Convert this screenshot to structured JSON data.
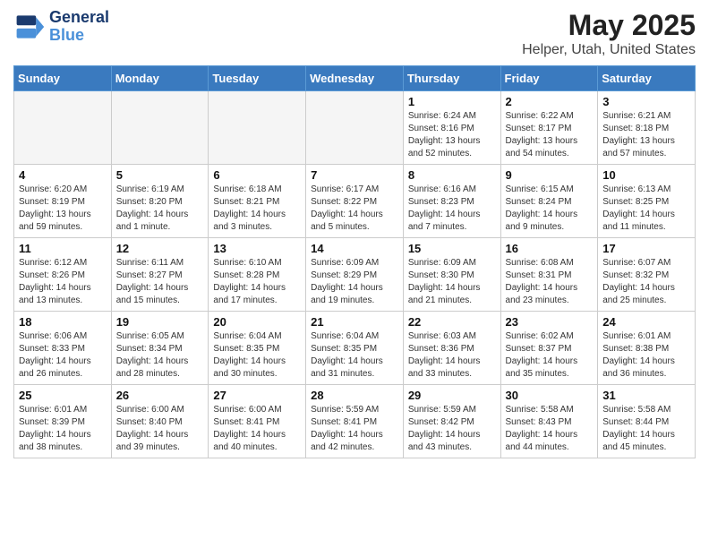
{
  "header": {
    "logo_line1": "General",
    "logo_line2": "Blue",
    "title": "May 2025",
    "subtitle": "Helper, Utah, United States"
  },
  "weekdays": [
    "Sunday",
    "Monday",
    "Tuesday",
    "Wednesday",
    "Thursday",
    "Friday",
    "Saturday"
  ],
  "weeks": [
    [
      {
        "day": "",
        "info": ""
      },
      {
        "day": "",
        "info": ""
      },
      {
        "day": "",
        "info": ""
      },
      {
        "day": "",
        "info": ""
      },
      {
        "day": "1",
        "info": "Sunrise: 6:24 AM\nSunset: 8:16 PM\nDaylight: 13 hours\nand 52 minutes."
      },
      {
        "day": "2",
        "info": "Sunrise: 6:22 AM\nSunset: 8:17 PM\nDaylight: 13 hours\nand 54 minutes."
      },
      {
        "day": "3",
        "info": "Sunrise: 6:21 AM\nSunset: 8:18 PM\nDaylight: 13 hours\nand 57 minutes."
      }
    ],
    [
      {
        "day": "4",
        "info": "Sunrise: 6:20 AM\nSunset: 8:19 PM\nDaylight: 13 hours\nand 59 minutes."
      },
      {
        "day": "5",
        "info": "Sunrise: 6:19 AM\nSunset: 8:20 PM\nDaylight: 14 hours\nand 1 minute."
      },
      {
        "day": "6",
        "info": "Sunrise: 6:18 AM\nSunset: 8:21 PM\nDaylight: 14 hours\nand 3 minutes."
      },
      {
        "day": "7",
        "info": "Sunrise: 6:17 AM\nSunset: 8:22 PM\nDaylight: 14 hours\nand 5 minutes."
      },
      {
        "day": "8",
        "info": "Sunrise: 6:16 AM\nSunset: 8:23 PM\nDaylight: 14 hours\nand 7 minutes."
      },
      {
        "day": "9",
        "info": "Sunrise: 6:15 AM\nSunset: 8:24 PM\nDaylight: 14 hours\nand 9 minutes."
      },
      {
        "day": "10",
        "info": "Sunrise: 6:13 AM\nSunset: 8:25 PM\nDaylight: 14 hours\nand 11 minutes."
      }
    ],
    [
      {
        "day": "11",
        "info": "Sunrise: 6:12 AM\nSunset: 8:26 PM\nDaylight: 14 hours\nand 13 minutes."
      },
      {
        "day": "12",
        "info": "Sunrise: 6:11 AM\nSunset: 8:27 PM\nDaylight: 14 hours\nand 15 minutes."
      },
      {
        "day": "13",
        "info": "Sunrise: 6:10 AM\nSunset: 8:28 PM\nDaylight: 14 hours\nand 17 minutes."
      },
      {
        "day": "14",
        "info": "Sunrise: 6:09 AM\nSunset: 8:29 PM\nDaylight: 14 hours\nand 19 minutes."
      },
      {
        "day": "15",
        "info": "Sunrise: 6:09 AM\nSunset: 8:30 PM\nDaylight: 14 hours\nand 21 minutes."
      },
      {
        "day": "16",
        "info": "Sunrise: 6:08 AM\nSunset: 8:31 PM\nDaylight: 14 hours\nand 23 minutes."
      },
      {
        "day": "17",
        "info": "Sunrise: 6:07 AM\nSunset: 8:32 PM\nDaylight: 14 hours\nand 25 minutes."
      }
    ],
    [
      {
        "day": "18",
        "info": "Sunrise: 6:06 AM\nSunset: 8:33 PM\nDaylight: 14 hours\nand 26 minutes."
      },
      {
        "day": "19",
        "info": "Sunrise: 6:05 AM\nSunset: 8:34 PM\nDaylight: 14 hours\nand 28 minutes."
      },
      {
        "day": "20",
        "info": "Sunrise: 6:04 AM\nSunset: 8:35 PM\nDaylight: 14 hours\nand 30 minutes."
      },
      {
        "day": "21",
        "info": "Sunrise: 6:04 AM\nSunset: 8:35 PM\nDaylight: 14 hours\nand 31 minutes."
      },
      {
        "day": "22",
        "info": "Sunrise: 6:03 AM\nSunset: 8:36 PM\nDaylight: 14 hours\nand 33 minutes."
      },
      {
        "day": "23",
        "info": "Sunrise: 6:02 AM\nSunset: 8:37 PM\nDaylight: 14 hours\nand 35 minutes."
      },
      {
        "day": "24",
        "info": "Sunrise: 6:01 AM\nSunset: 8:38 PM\nDaylight: 14 hours\nand 36 minutes."
      }
    ],
    [
      {
        "day": "25",
        "info": "Sunrise: 6:01 AM\nSunset: 8:39 PM\nDaylight: 14 hours\nand 38 minutes."
      },
      {
        "day": "26",
        "info": "Sunrise: 6:00 AM\nSunset: 8:40 PM\nDaylight: 14 hours\nand 39 minutes."
      },
      {
        "day": "27",
        "info": "Sunrise: 6:00 AM\nSunset: 8:41 PM\nDaylight: 14 hours\nand 40 minutes."
      },
      {
        "day": "28",
        "info": "Sunrise: 5:59 AM\nSunset: 8:41 PM\nDaylight: 14 hours\nand 42 minutes."
      },
      {
        "day": "29",
        "info": "Sunrise: 5:59 AM\nSunset: 8:42 PM\nDaylight: 14 hours\nand 43 minutes."
      },
      {
        "day": "30",
        "info": "Sunrise: 5:58 AM\nSunset: 8:43 PM\nDaylight: 14 hours\nand 44 minutes."
      },
      {
        "day": "31",
        "info": "Sunrise: 5:58 AM\nSunset: 8:44 PM\nDaylight: 14 hours\nand 45 minutes."
      }
    ]
  ]
}
